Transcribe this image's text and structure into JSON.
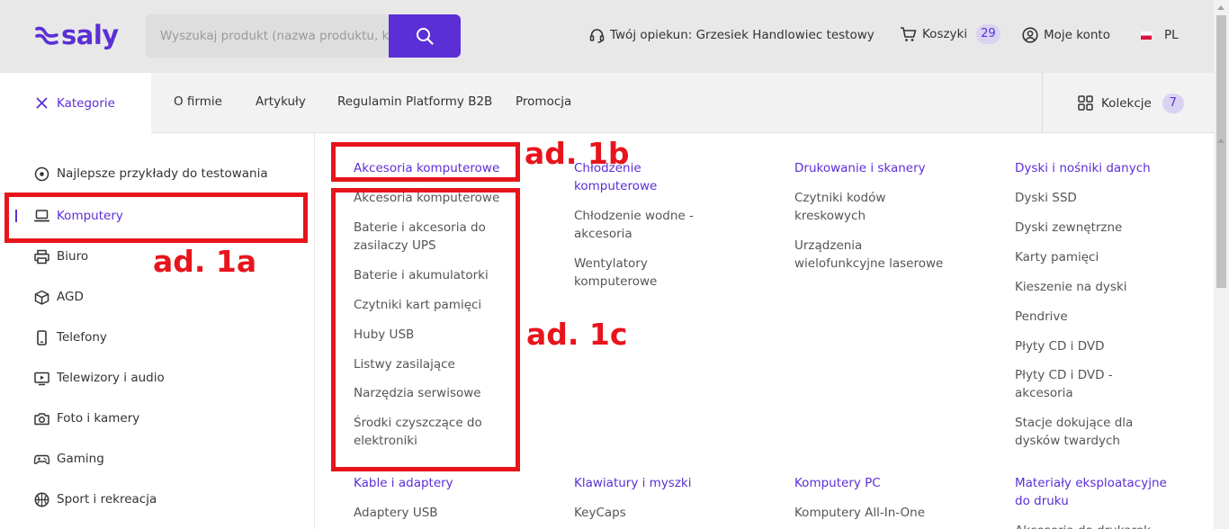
{
  "brand": {
    "name": "saly",
    "color": "#5b2fd6"
  },
  "header": {
    "search_placeholder": "Wyszukaj produkt (nazwa produktu, kod)",
    "search_icon": "search-icon",
    "guardian_label": "Twój opiekun: Grzesiek Handlowiec testowy",
    "carts_label": "Koszyki",
    "carts_count": "29",
    "account_label": "Moje konto",
    "language_label": "PL"
  },
  "nav": {
    "categories_label": "Kategorie",
    "links": [
      "O firmie",
      "Artykuły",
      "Regulamin Platformy B2B",
      "Promocja"
    ],
    "collections_label": "Kolekcje",
    "collections_count": "7"
  },
  "sidebar": {
    "items": [
      {
        "label": "Najlepsze przykłady do testowania",
        "icon": "target-icon"
      },
      {
        "label": "Komputery",
        "icon": "laptop-icon",
        "active": true
      },
      {
        "label": "Biuro",
        "icon": "printer-icon"
      },
      {
        "label": "AGD",
        "icon": "box-icon"
      },
      {
        "label": "Telefony",
        "icon": "phone-icon"
      },
      {
        "label": "Telewizory i audio",
        "icon": "tv-icon"
      },
      {
        "label": "Foto i kamery",
        "icon": "camera-icon"
      },
      {
        "label": "Gaming",
        "icon": "gamepad-icon"
      },
      {
        "label": "Sport i rekreacja",
        "icon": "ball-icon"
      }
    ]
  },
  "categories": {
    "col1": {
      "heading": "Akcesoria komputerowe",
      "items": [
        "Akcesoria komputerowe",
        "Baterie i akcesoria do zasilaczy UPS",
        "Baterie i akumulatorki",
        "Czytniki kart pamięci",
        "Huby USB",
        "Listwy zasilające",
        "Narzędzia serwisowe",
        "Środki czyszczące do elektroniki"
      ],
      "heading2": "Kable i adaptery",
      "items2": [
        "Adaptery USB"
      ]
    },
    "col2": {
      "heading": "Chłodzenie komputerowe",
      "items": [
        "Chłodzenie wodne - akcesoria",
        "Wentylatory komputerowe"
      ],
      "heading2": "Klawiatury i myszki",
      "items2": [
        "KeyCaps"
      ]
    },
    "col3": {
      "heading": "Drukowanie i skanery",
      "items": [
        "Czytniki kodów kreskowych",
        "Urządzenia wielofunkcyjne laserowe"
      ],
      "heading2": "Komputery PC",
      "items2": [
        "Komputery All-In-One"
      ]
    },
    "col4": {
      "heading": "Dyski i nośniki danych",
      "items": [
        "Dyski SSD",
        "Dyski zewnętrzne",
        "Karty pamięci",
        "Kieszenie na dyski",
        "Pendrive",
        "Płyty CD i DVD",
        "Płyty CD i DVD - akcesoria",
        "Stacje dokujące dla dysków twardych"
      ],
      "heading2": "Materiały eksploatacyjne do druku",
      "items2": [
        "Akcesoria do drukarek"
      ]
    }
  },
  "annotations": {
    "label_1a": "ad. 1a",
    "label_1b": "ad. 1b",
    "label_1c": "ad. 1c",
    "color": "#e8141c"
  }
}
